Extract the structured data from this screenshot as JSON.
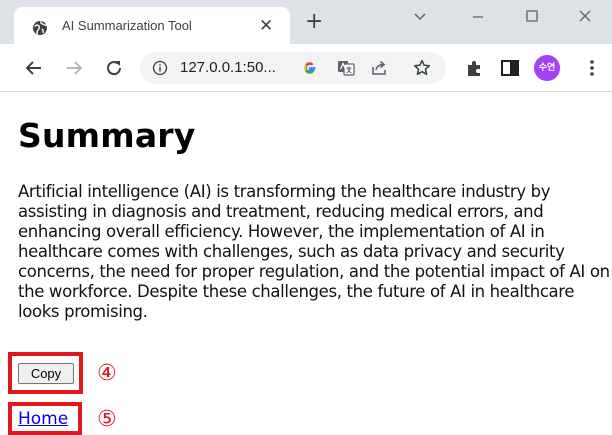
{
  "browser": {
    "tab": {
      "title": "AI Summarization Tool",
      "favicon": "globe-icon",
      "close_glyph": "✕"
    },
    "new_tab_glyph": "+",
    "url": "127.0.0.1:50...",
    "profile_avatar_text": "수연",
    "icons": [
      "back-arrow-icon",
      "forward-arrow-icon",
      "reload-icon",
      "info-icon",
      "google-icon",
      "translate-icon",
      "share-icon",
      "bookmark-star-icon",
      "extensions-icon",
      "side-panel-icon",
      "more-menu-icon"
    ]
  },
  "page": {
    "title": "Summary",
    "summary": "Artificial intelligence (AI) is transforming the healthcare industry by assisting in diagnosis and treatment, reducing medical errors, and enhancing overall efficiency. However, the implementation of AI in healthcare comes with challenges, such as data privacy and security concerns, the need for proper regulation, and the potential impact of AI on the workforce. Despite these challenges, the future of AI in healthcare looks promising.",
    "copy_label": "Copy",
    "home_label": "Home"
  },
  "annotations": {
    "copy_marker": "④",
    "home_marker": "⑤",
    "highlight_color": "#e0181e"
  }
}
